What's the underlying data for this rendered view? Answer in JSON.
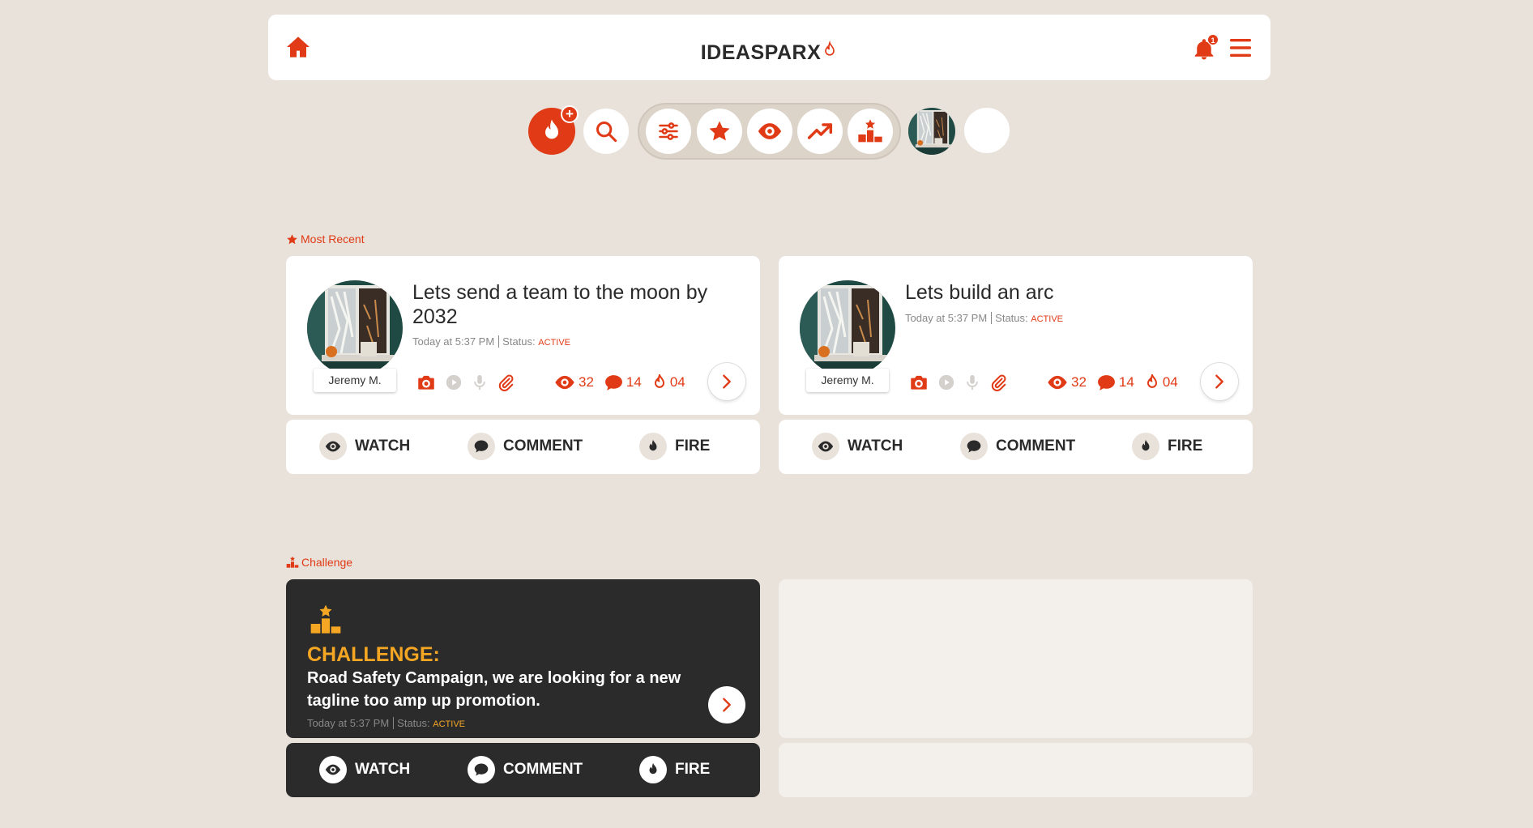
{
  "header": {
    "logo_text": "IDEASPARX",
    "notification_count": "1",
    "icons": {
      "home": "home-icon",
      "flame": "flame-icon",
      "bell": "bell-icon",
      "menu": "hamburger-menu-icon"
    }
  },
  "toolbar": {
    "items": [
      "new-idea-flame-plus-icon",
      "search-icon",
      "filter-sliders-icon",
      "star-icon",
      "eye-icon",
      "trending-up-icon",
      "podium-icon",
      "user-avatar",
      "blank-circle"
    ]
  },
  "sections": {
    "most_recent_label": "Most Recent",
    "challenge_label": "Challenge"
  },
  "ideas": [
    {
      "title": "Lets send a team to the moon by 2032",
      "author": "Jeremy M.",
      "time": "Today at 5:37 PM",
      "status_label": "Status:",
      "status": "ACTIVE",
      "views": "32",
      "comments": "14",
      "fires": "04"
    },
    {
      "title": "Lets build an arc",
      "author": "Jeremy M.",
      "time": "Today at 5:37 PM",
      "status_label": "Status:",
      "status": "ACTIVE",
      "views": "32",
      "comments": "14",
      "fires": "04"
    }
  ],
  "actions": {
    "watch": "WATCH",
    "comment": "COMMENT",
    "fire": "FIRE"
  },
  "challenge": {
    "heading": "CHALLENGE:",
    "description": "Road Safety Campaign, we are looking for a new tagline too amp up promotion.",
    "time": "Today at 5:37 PM",
    "status_label": "Status:",
    "status": "ACTIVE"
  },
  "colors": {
    "accent": "#e03a16",
    "challenge_accent": "#f5a623",
    "background": "#e9e2db",
    "dark_card": "#2b2b2b"
  }
}
